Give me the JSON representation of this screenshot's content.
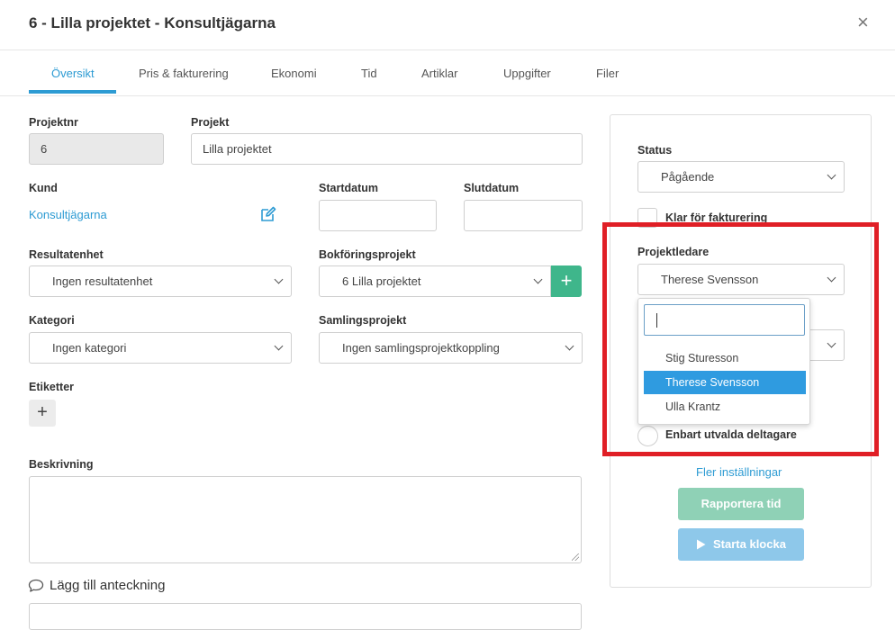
{
  "window": {
    "title": "6 - Lilla projektet - Konsultjägarna",
    "close_glyph": "×"
  },
  "tabs": [
    {
      "label": "Översikt"
    },
    {
      "label": "Pris & fakturering"
    },
    {
      "label": "Ekonomi"
    },
    {
      "label": "Tid"
    },
    {
      "label": "Artiklar"
    },
    {
      "label": "Uppgifter"
    },
    {
      "label": "Filer"
    }
  ],
  "form": {
    "projektnr_label": "Projektnr",
    "projektnr_value": "6",
    "projekt_label": "Projekt",
    "projekt_value": "Lilla projektet",
    "kund_label": "Kund",
    "kund_value": "Konsultjägarna",
    "startdatum_label": "Startdatum",
    "startdatum_value": "",
    "slutdatum_label": "Slutdatum",
    "slutdatum_value": "",
    "resultatenhet_label": "Resultatenhet",
    "resultatenhet_value": "Ingen resultatenhet",
    "bokforing_label": "Bokföringsprojekt",
    "bokforing_value": "6 Lilla projektet",
    "kategori_label": "Kategori",
    "kategori_value": "Ingen kategori",
    "samlings_label": "Samlingsprojekt",
    "samlings_value": "Ingen samlingsprojektkoppling",
    "etiketter_label": "Etiketter",
    "beskrivning_label": "Beskrivning",
    "anteckning_label": "Lägg till anteckning"
  },
  "panel": {
    "status_label": "Status",
    "status_value": "Pågående",
    "klar_label": "Klar för fakturering",
    "projektledare_label": "Projektledare",
    "projektledare_value": "Therese Svensson",
    "enbart_label": "Enbart utvalda deltagare",
    "fler_label": "Fler inställningar",
    "rapportera_label": "Rapportera tid",
    "starta_label": "Starta klocka"
  },
  "dropdown": {
    "search_value": "",
    "options": [
      "Stig Sturesson",
      "Therese Svensson",
      "Ulla Krantz"
    ],
    "selected": "Therese Svensson"
  },
  "colors": {
    "accent": "#2d9bd3",
    "green": "#3fb68b",
    "rapportera_bg": "#8fd1b6",
    "starta_bg": "#8ec8ea",
    "highlight": "#e01f26",
    "selected_option": "#2f9be0"
  }
}
